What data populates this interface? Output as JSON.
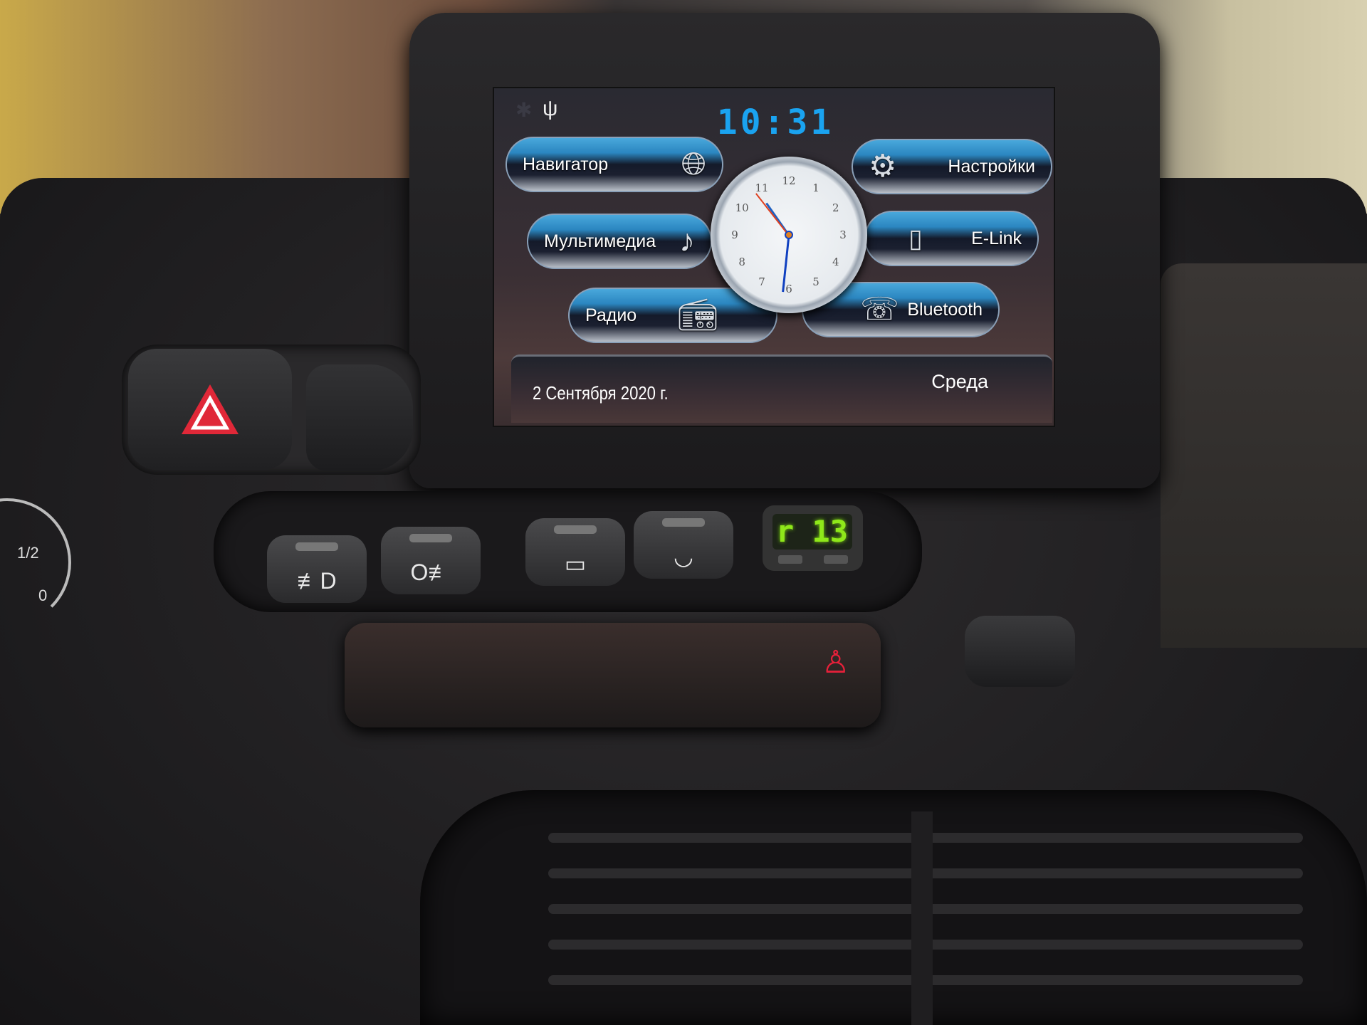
{
  "head_unit": {
    "status": {
      "bluetooth_icon": "bluetooth-icon",
      "usb_icon": "usb-icon"
    },
    "time": "10:31",
    "menu": [
      {
        "label": "Навигатор",
        "icon": "globe-icon"
      },
      {
        "label": "Настройки",
        "icon": "gear-icon"
      },
      {
        "label": "Мультимедиа",
        "icon": "music-note-icon"
      },
      {
        "label": "E-Link",
        "icon": "phone-usb-icon"
      },
      {
        "label": "Радио",
        "icon": "radio-icon"
      },
      {
        "label": "Bluetooth",
        "icon": "bluetooth-phone-icon"
      }
    ],
    "clock_numbers": [
      "12",
      "1",
      "2",
      "3",
      "4",
      "5",
      "6",
      "7",
      "8",
      "9",
      "10",
      "11"
    ],
    "date": "2 Сентября 2020 г.",
    "weekday": "Среда",
    "accent_color": "#1aa3f0"
  },
  "dashboard": {
    "temperature_display": "r 13",
    "temperature_display_color": "#8fe81a",
    "gauge_labels": [
      "1/2",
      "0"
    ],
    "switches": [
      "front-fog-light-icon",
      "rear-fog-light-icon",
      "rear-defrost-icon",
      "windshield-defrost-icon"
    ],
    "seatbelt_warning_color": "#e8203a"
  }
}
